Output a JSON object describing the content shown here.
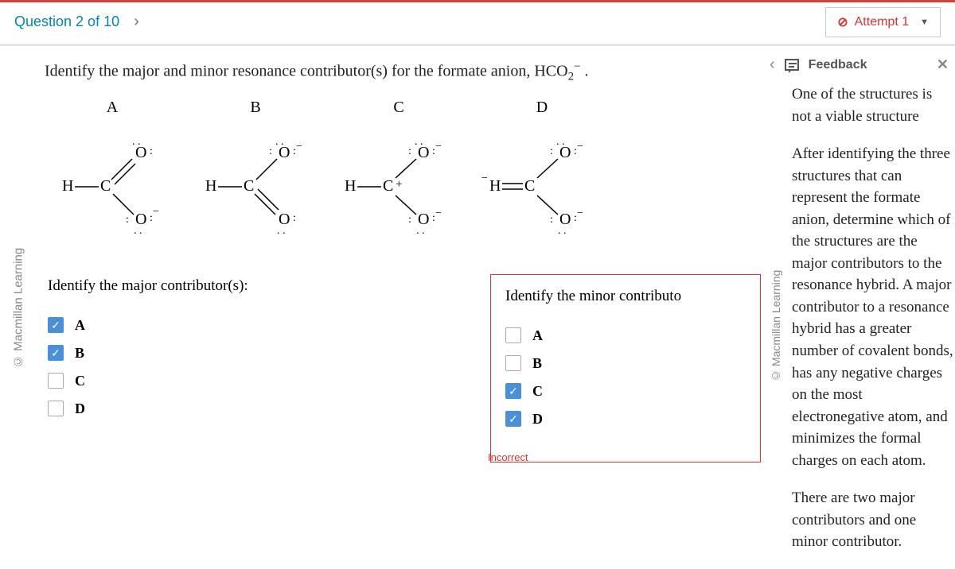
{
  "topbar": {
    "question_label": "Question 2 of 10",
    "attempt_label": "Attempt 1"
  },
  "prompt_pre": "Identify the major and minor resonance contributor(s) for the formate anion,  HCO",
  "prompt_sub": "2",
  "prompt_sup": "−",
  "prompt_post": " .",
  "structures": {
    "A": "A",
    "B": "B",
    "C": "C",
    "D": "D"
  },
  "major": {
    "title": "Identify the major contributor(s):",
    "options": [
      {
        "label": "A",
        "checked": true
      },
      {
        "label": "B",
        "checked": true
      },
      {
        "label": "C",
        "checked": false
      },
      {
        "label": "D",
        "checked": false
      }
    ]
  },
  "minor": {
    "title": "Identify the minor contributo",
    "options": [
      {
        "label": "A",
        "checked": false
      },
      {
        "label": "B",
        "checked": false
      },
      {
        "label": "C",
        "checked": true
      },
      {
        "label": "D",
        "checked": true
      }
    ],
    "incorrect_label": "Incorrect"
  },
  "feedback": {
    "header": "Feedback",
    "p1": "One of the structures is not a viable structure",
    "p2": "After identifying the three structures that can represent the formate anion, determine which of the structures are the major contributors to the resonance hybrid. A major contributor to a resonance hybrid has a greater number of covalent bonds, has any negative charges on the most electronegative atom, and minimizes the formal charges on each atom.",
    "p3": "There are two major contributors and one minor contributor."
  },
  "brand": "© Macmillan Learning"
}
